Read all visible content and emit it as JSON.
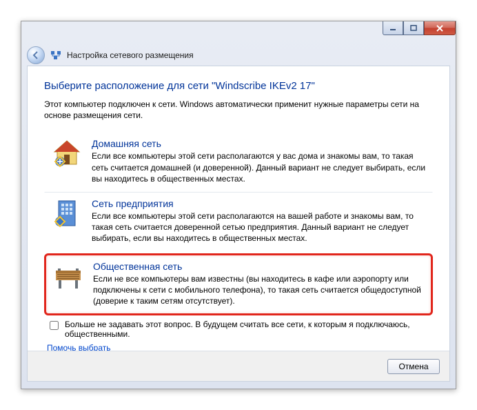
{
  "window": {
    "title": "Настройка сетевого размещения"
  },
  "heading": "Выберите расположение для сети \"Windscribe IKEv2  17\"",
  "intro": "Этот компьютер подключен к сети. Windows автоматически применит нужные параметры сети на основе размещения сети.",
  "options": {
    "home": {
      "title": "Домашняя сеть",
      "desc": "Если все компьютеры этой сети располагаются у вас дома и знакомы вам, то такая сеть считается домашней (и доверенной). Данный вариант не следует выбирать, если вы находитесь в общественных местах."
    },
    "work": {
      "title": "Сеть предприятия",
      "desc": "Если все компьютеры этой сети располагаются на вашей работе и знакомы вам, то такая сеть считается доверенной сетью предприятия. Данный вариант не следует выбирать, если вы находитесь в общественных местах."
    },
    "public": {
      "title": "Общественная сеть",
      "desc": "Если не все компьютеры вам известны (вы находитесь в кафе или аэропорту или подключены к сети с мобильного телефона), то такая сеть считается общедоступной (доверие к таким сетям отсутствует)."
    }
  },
  "checkbox_label": "Больше не задавать этот вопрос. В будущем считать все сети, к которым я подключаюсь, общественными.",
  "help_link": "Помочь выбрать",
  "buttons": {
    "cancel": "Отмена"
  }
}
